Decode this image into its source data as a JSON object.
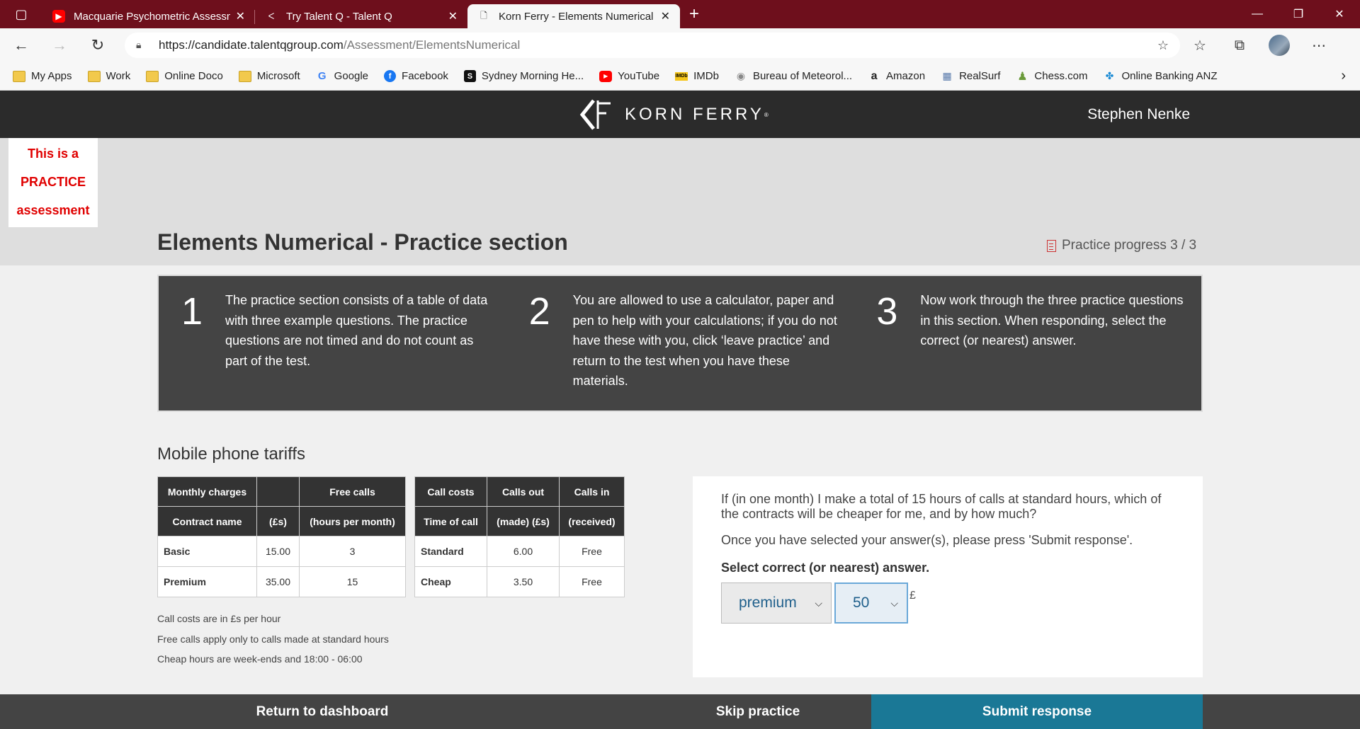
{
  "browser": {
    "tabs": [
      {
        "title": "Macquarie Psychometric Assessm",
        "active": false
      },
      {
        "title": "Try Talent Q - Talent Q",
        "active": false
      },
      {
        "title": "Korn Ferry - Elements Numerical",
        "active": true
      }
    ],
    "url_host": "https://candidate.talentqgroup.com",
    "url_path": "/Assessment/ElementsNumerical",
    "bookmarks": [
      "My Apps",
      "Work",
      "Online Doco",
      "Microsoft",
      "Google",
      "Facebook",
      "Sydney Morning He...",
      "YouTube",
      "IMDb",
      "Bureau of Meteorol...",
      "Amazon",
      "RealSurf",
      "Chess.com",
      "Online Banking ANZ"
    ]
  },
  "header": {
    "logo_text": "KORN FERRY",
    "logo_mark": "®",
    "user_name": "Stephen Nenke"
  },
  "banner": {
    "line1": "This is a",
    "line2": "PRACTICE",
    "line3": "assessment"
  },
  "page": {
    "title": "Elements Numerical - Practice section",
    "progress": "Practice progress 3 / 3"
  },
  "steps": [
    {
      "num": "1",
      "text": "The practice section consists of a table of data with three example questions. The practice questions are not timed and do not count as part of the test."
    },
    {
      "num": "2",
      "text": "You are allowed to use a calculator, paper and pen to help with your calculations; if you do not have these with you, click ‘leave practice’ and return to the test when you have these materials."
    },
    {
      "num": "3",
      "text": "Now work through the three practice questions in this section. When responding, select the correct (or nearest) answer."
    }
  ],
  "tariffs": {
    "title": "Mobile phone tariffs",
    "table1": {
      "header1": [
        "Monthly charges",
        "",
        "Free calls"
      ],
      "header2": [
        "Contract name",
        "(£s)",
        "(hours per month)"
      ],
      "rows": [
        [
          "Basic",
          "15.00",
          "3"
        ],
        [
          "Premium",
          "35.00",
          "15"
        ]
      ]
    },
    "table2": {
      "header1": [
        "Call costs",
        "Calls out",
        "Calls in"
      ],
      "header2": [
        "Time of call",
        "(made) (£s)",
        "(received)"
      ],
      "rows": [
        [
          "Standard",
          "6.00",
          "Free"
        ],
        [
          "Cheap",
          "3.50",
          "Free"
        ]
      ]
    },
    "notes": [
      "Call costs are in £s per hour",
      "Free calls apply only to calls made at standard hours",
      "Cheap hours are week-ends and 18:00 - 06:00"
    ]
  },
  "question": {
    "text": "If (in one month) I make a total of 15 hours of calls at standard hours, which of the contracts will be cheaper for me, and by how much?",
    "instruction": "Once you have selected your answer(s), please press 'Submit response'.",
    "select_label": "Select correct (or nearest) answer.",
    "answer_contract": "premium",
    "answer_amount": "50",
    "currency": "£"
  },
  "footer": {
    "dashboard": "Return to dashboard",
    "skip": "Skip practice",
    "submit": "Submit response"
  }
}
